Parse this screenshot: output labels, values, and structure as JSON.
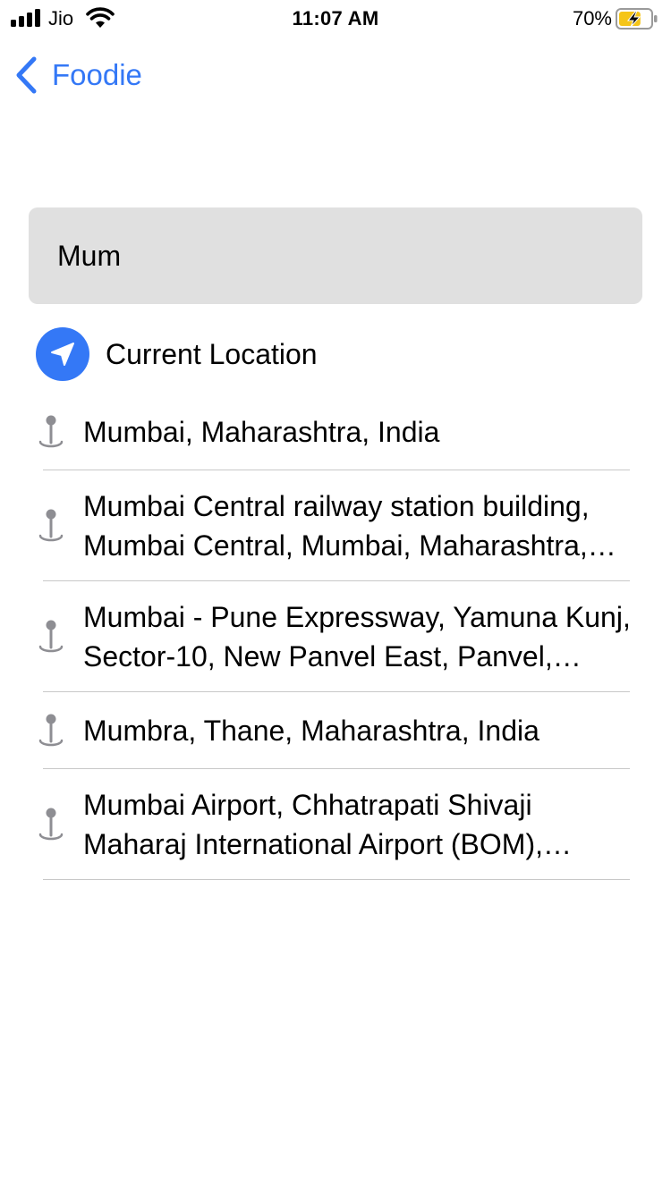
{
  "status_bar": {
    "carrier": "Jio",
    "time": "11:07 AM",
    "battery_percent": "70%",
    "battery_level": 0.7,
    "charging": true,
    "signal_icon": "cellular-signal-icon",
    "wifi_icon": "wifi-icon",
    "battery_icon": "battery-charging-icon"
  },
  "nav": {
    "back_label": "Foodie",
    "back_icon": "chevron-left-icon"
  },
  "search": {
    "value": "Mum"
  },
  "current_location": {
    "label": "Current Location",
    "icon": "location-arrow-icon"
  },
  "results": [
    {
      "text": "Mumbai, Maharashtra, India",
      "lines": 1
    },
    {
      "text": "Mumbai Central railway station building, Mumbai Central, Mumbai, Maharashtra, India",
      "lines": 2
    },
    {
      "text": "Mumbai - Pune Expressway, Yamuna Kunj, Sector-10, New Panvel East, Panvel, Maharashtra, India",
      "lines": 2
    },
    {
      "text": "Mumbra, Thane, Maharashtra, India",
      "lines": 1
    },
    {
      "text": "Mumbai Airport, Chhatrapati Shivaji Maharaj International Airport (BOM), Navpada, Vile Parle East, Mumbai, Maharashtra, India",
      "lines": 2
    }
  ],
  "colors": {
    "accent": "#3478f6",
    "search_bg": "#e0e0e0",
    "pin": "#8e8e93",
    "battery_fill": "#f5c518"
  }
}
